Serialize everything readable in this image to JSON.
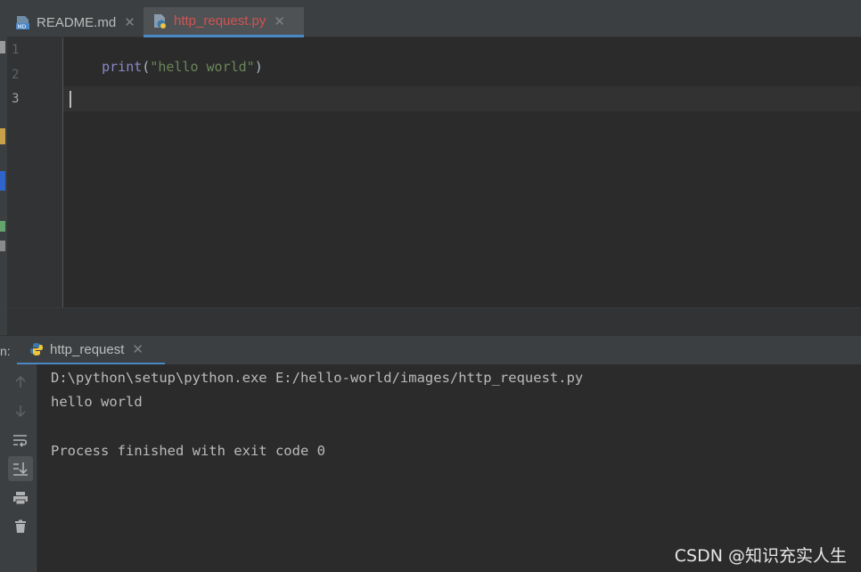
{
  "tabs": [
    {
      "label": "README.md",
      "icon": "markdown-file-icon",
      "active": false
    },
    {
      "label": "http_request.py",
      "icon": "python-file-icon",
      "active": true
    }
  ],
  "editor": {
    "line_numbers": [
      "1",
      "2",
      "3"
    ],
    "current_line": 3,
    "code": {
      "func": "print",
      "open": "(",
      "string": "\"hello world\"",
      "close": ")"
    }
  },
  "run_panel": {
    "title": "n:",
    "tab_label": "http_request",
    "toolbar": [
      "arrow-up-icon",
      "arrow-down-icon",
      "soft-wrap-icon",
      "scroll-to-end-icon",
      "print-icon",
      "trash-icon"
    ],
    "console_lines": [
      "D:\\python\\setup\\python.exe E:/hello-world/images/http_request.py",
      "hello world",
      "",
      "Process finished with exit code 0"
    ]
  },
  "watermark": "CSDN @知识充实人生",
  "colors": {
    "accent": "#4a88c7",
    "active_tab_text": "#d25252",
    "keyword": "#8888c6",
    "string": "#6a8759",
    "background": "#2b2b2b"
  }
}
